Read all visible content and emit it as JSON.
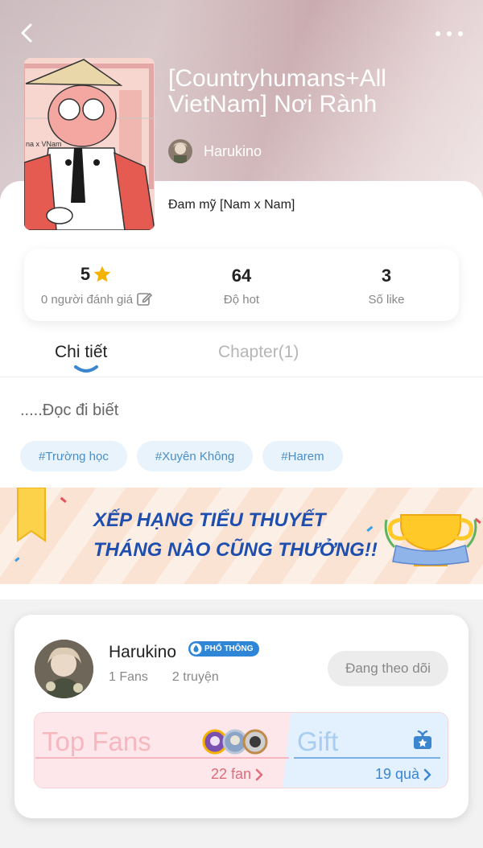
{
  "header": {
    "back_icon": "chevron-left-icon",
    "more_icon": "more-horizontal-icon"
  },
  "story": {
    "title": "[Countryhumans+All VietNam] Nơi Rành",
    "author": "Harukino",
    "genre": "Đam mỹ [Nam x Nam]"
  },
  "stats": {
    "rating": {
      "value": "5",
      "label": "0 người đánh giá"
    },
    "hot": {
      "value": "64",
      "label": "Độ hot"
    },
    "likes": {
      "value": "3",
      "label": "Số like"
    }
  },
  "tabs": {
    "detail": "Chi tiết",
    "chapters": "Chapter(1)"
  },
  "description": ".....Đọc đi biết",
  "tags": [
    "#Trường học",
    "#Xuyên Không",
    "#Harem"
  ],
  "banner": {
    "line1": "XẾP HẠNG TIỂU THUYẾT",
    "line2": "THÁNG NÀO CŨNG THƯỞNG!!"
  },
  "author_card": {
    "name": "Harukino",
    "badge": "PHỔ THÔNG",
    "fans": "1 Fans",
    "stories": "2 truyện",
    "follow_label": "Đang theo dõi",
    "top_fans_title": "Top Fans",
    "fan_count": "22 fan",
    "gift_title": "Gift",
    "gift_count": "19 quà"
  },
  "colors": {
    "accent_blue": "#3b86cf",
    "tag_bg": "#e8f3fc",
    "star": "#f5b301",
    "banner_text": "#1f4fae"
  }
}
